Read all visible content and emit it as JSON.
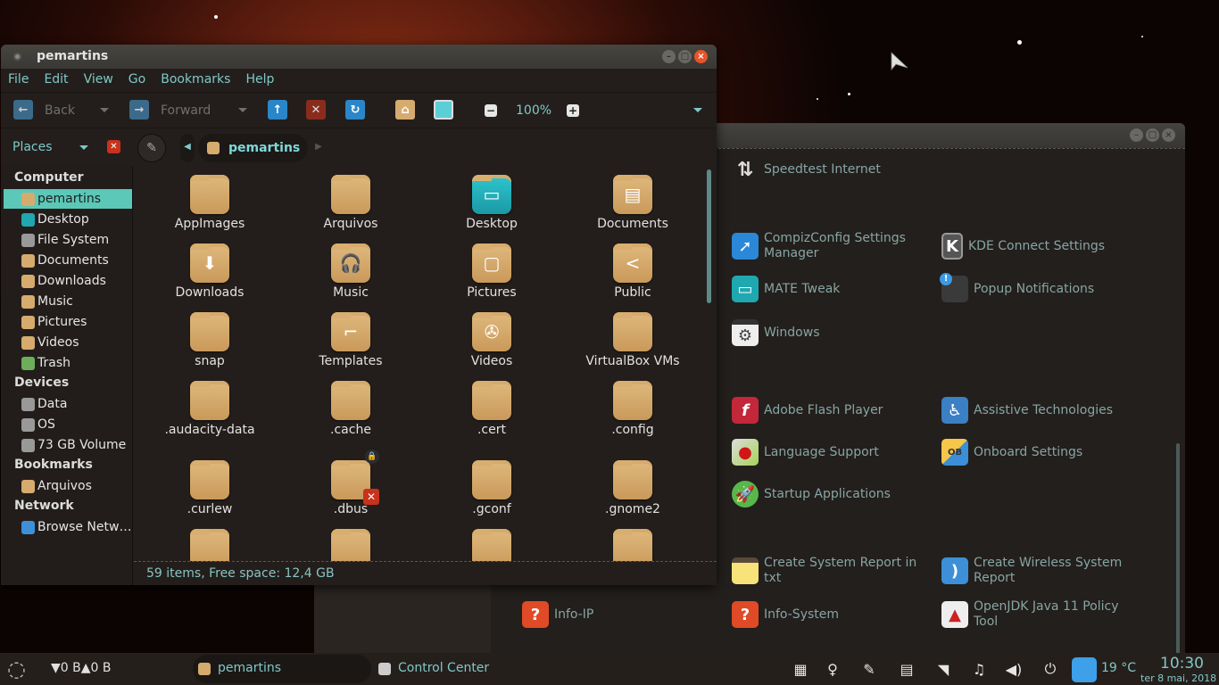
{
  "desktop": {
    "wallpaper": "nebula-red"
  },
  "file_manager": {
    "title": "pemartins",
    "menu": [
      "File",
      "Edit",
      "View",
      "Go",
      "Bookmarks",
      "Help"
    ],
    "toolbar": {
      "back_label": "Back",
      "forward_label": "Forward",
      "zoom_level": "100%"
    },
    "places_label": "Places",
    "breadcrumb": "pemartins",
    "sidebar": {
      "sections": [
        {
          "title": "Computer",
          "items": [
            "pemartins",
            "Desktop",
            "File System",
            "Documents",
            "Downloads",
            "Music",
            "Pictures",
            "Videos",
            "Trash"
          ]
        },
        {
          "title": "Devices",
          "items": [
            "Data",
            "OS",
            "73 GB Volume"
          ]
        },
        {
          "title": "Bookmarks",
          "items": [
            "Arquivos"
          ]
        },
        {
          "title": "Network",
          "items": [
            "Browse Netw…"
          ]
        }
      ],
      "selected": "pemartins"
    },
    "items": [
      {
        "name": "AppImages",
        "icon": "folder"
      },
      {
        "name": "Arquivos",
        "icon": "folder"
      },
      {
        "name": "Desktop",
        "icon": "desktop-folder"
      },
      {
        "name": "Documents",
        "icon": "documents-folder"
      },
      {
        "name": "Downloads",
        "icon": "downloads-folder"
      },
      {
        "name": "Music",
        "icon": "music-folder"
      },
      {
        "name": "Pictures",
        "icon": "pictures-folder"
      },
      {
        "name": "Public",
        "icon": "public-folder"
      },
      {
        "name": "snap",
        "icon": "folder"
      },
      {
        "name": "Templates",
        "icon": "templates-folder"
      },
      {
        "name": "Videos",
        "icon": "videos-folder"
      },
      {
        "name": "VirtualBox VMs",
        "icon": "folder"
      },
      {
        "name": ".audacity-data",
        "icon": "folder"
      },
      {
        "name": ".cache",
        "icon": "folder"
      },
      {
        "name": ".cert",
        "icon": "folder"
      },
      {
        "name": ".config",
        "icon": "folder"
      },
      {
        "name": ".curlew",
        "icon": "folder"
      },
      {
        "name": ".dbus",
        "icon": "locked-folder"
      },
      {
        "name": ".gconf",
        "icon": "folder"
      },
      {
        "name": ".gnome2",
        "icon": "folder"
      },
      {
        "name": "",
        "icon": "folder"
      },
      {
        "name": "",
        "icon": "folder"
      },
      {
        "name": "",
        "icon": "folder"
      },
      {
        "name": "",
        "icon": "folder"
      }
    ],
    "status": "59 items, Free space: 12,4 GB"
  },
  "control_center": {
    "items": [
      {
        "label": "Speedtest Internet",
        "icon": "arrows-updown-icon"
      },
      {
        "label": "CompizConfig Settings Manager",
        "icon": "compiz-icon"
      },
      {
        "label": "KDE Connect Settings",
        "icon": "kde-connect-icon"
      },
      {
        "label": "MATE Tweak",
        "icon": "mate-tweak-icon"
      },
      {
        "label": "Popup Notifications",
        "icon": "notification-icon"
      },
      {
        "label": "Windows",
        "icon": "windows-settings-icon"
      },
      {
        "label": "Adobe Flash Player",
        "icon": "flash-icon"
      },
      {
        "label": "Assistive Technologies",
        "icon": "accessibility-icon"
      },
      {
        "label": "Language Support",
        "icon": "language-icon"
      },
      {
        "label": "Onboard Settings",
        "icon": "onboard-icon"
      },
      {
        "label": "Startup Applications",
        "icon": "startup-icon"
      },
      {
        "label": "Create System Report in txt",
        "icon": "notepad-icon"
      },
      {
        "label": "Create Wireless System Report",
        "icon": "rss-icon"
      },
      {
        "label": "Info-IP",
        "icon": "help-icon"
      },
      {
        "label": "Info-System",
        "icon": "help-icon"
      },
      {
        "label": "OpenJDK Java 11 Policy Tool",
        "icon": "java-icon"
      }
    ]
  },
  "taskbar": {
    "net_down": "0 B",
    "net_up": "0 B",
    "tasks": [
      {
        "label": "pemartins",
        "active": true
      },
      {
        "label": "Control Center",
        "active": false
      }
    ],
    "weather_temp": "19 °C",
    "time": "10:30",
    "date": "ter  8 mai, 2018"
  },
  "colors": {
    "accent": "#5bc8b8",
    "text_accent": "#7fc8c8",
    "folder": "#d6ab6e"
  }
}
